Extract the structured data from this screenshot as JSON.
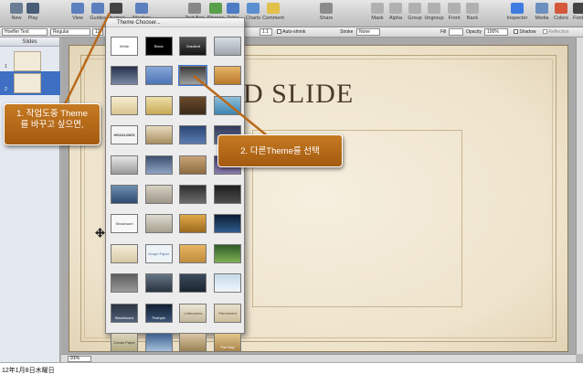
{
  "toolbar": {
    "buttons": [
      {
        "label": "New",
        "icon": "new-icon"
      },
      {
        "label": "Play",
        "icon": "play-icon"
      },
      {
        "label": "View",
        "icon": "view-icon"
      },
      {
        "label": "Guides",
        "icon": "guides-icon"
      },
      {
        "label": "Themes",
        "icon": "themes-icon"
      },
      {
        "label": "Masters",
        "icon": "masters-icon"
      },
      {
        "label": "Text Box",
        "icon": "textbox-icon"
      },
      {
        "label": "Shapes",
        "icon": "shapes-icon"
      },
      {
        "label": "Table",
        "icon": "table-icon"
      },
      {
        "label": "Charts",
        "icon": "charts-icon"
      },
      {
        "label": "Comment",
        "icon": "comment-icon"
      },
      {
        "label": "Share",
        "icon": "share-icon"
      },
      {
        "label": "Mask",
        "icon": "mask-icon"
      },
      {
        "label": "Alpha",
        "icon": "alpha-icon"
      },
      {
        "label": "Group",
        "icon": "group-icon"
      },
      {
        "label": "Ungroup",
        "icon": "ungroup-icon"
      },
      {
        "label": "Front",
        "icon": "front-icon"
      },
      {
        "label": "Back",
        "icon": "back-icon"
      },
      {
        "label": "Inspector",
        "icon": "inspector-icon"
      },
      {
        "label": "Media",
        "icon": "media-icon"
      },
      {
        "label": "Colors",
        "icon": "colors-icon"
      },
      {
        "label": "Fonts",
        "icon": "fonts-icon"
      }
    ]
  },
  "format_bar": {
    "font_family": "Hoefler Text",
    "font_style": "Regular",
    "font_size": "12",
    "line_spacing": "1.1",
    "auto_shrink": "Auto-shrink",
    "stroke_label": "Stroke",
    "stroke_value": "None",
    "fill_label": "Fill",
    "opacity_label": "Opacity",
    "opacity_value": "100%",
    "shadow_label": "Shadow",
    "reflection_label": "Reflection"
  },
  "navigator": {
    "header": "Slides",
    "slides": [
      {
        "number": "1"
      },
      {
        "number": "2"
      }
    ]
  },
  "slide": {
    "title": "D SLIDE"
  },
  "theme_chooser": {
    "title": "Theme Chooser...",
    "themes": [
      {
        "label": "White"
      },
      {
        "label": "Black"
      },
      {
        "label": "Gradient"
      },
      {
        "label": ""
      },
      {
        "label": ""
      },
      {
        "label": ""
      },
      {
        "label": ""
      },
      {
        "label": ""
      },
      {
        "label": ""
      },
      {
        "label": ""
      },
      {
        "label": ""
      },
      {
        "label": ""
      },
      {
        "label": "HEADLINES"
      },
      {
        "label": ""
      },
      {
        "label": ""
      },
      {
        "label": ""
      },
      {
        "label": ""
      },
      {
        "label": ""
      },
      {
        "label": ""
      },
      {
        "label": ""
      },
      {
        "label": ""
      },
      {
        "label": ""
      },
      {
        "label": ""
      },
      {
        "label": ""
      },
      {
        "label": "Showroom"
      },
      {
        "label": ""
      },
      {
        "label": ""
      },
      {
        "label": ""
      },
      {
        "label": ""
      },
      {
        "label": "Graph Paper"
      },
      {
        "label": ""
      },
      {
        "label": ""
      },
      {
        "label": ""
      },
      {
        "label": ""
      },
      {
        "label": ""
      },
      {
        "label": ""
      },
      {
        "label": "Blackboard"
      },
      {
        "label": "Pushpin"
      },
      {
        "label": "Letterpress"
      },
      {
        "label": "Parchment"
      },
      {
        "label": "Cream Paper"
      },
      {
        "label": ""
      },
      {
        "label": ""
      },
      {
        "label": "Fun Day"
      }
    ]
  },
  "callouts": {
    "step1_line1": "1. 작업도중 Theme",
    "step1_line2": "를 바꾸고 싶으면,",
    "step2": "2. 다른Theme를 선택"
  },
  "zoom": "91%",
  "status_bar": "12年1月8日木曜日",
  "colors": {
    "callout": "#b8691a",
    "selection": "#3e6fc2"
  }
}
